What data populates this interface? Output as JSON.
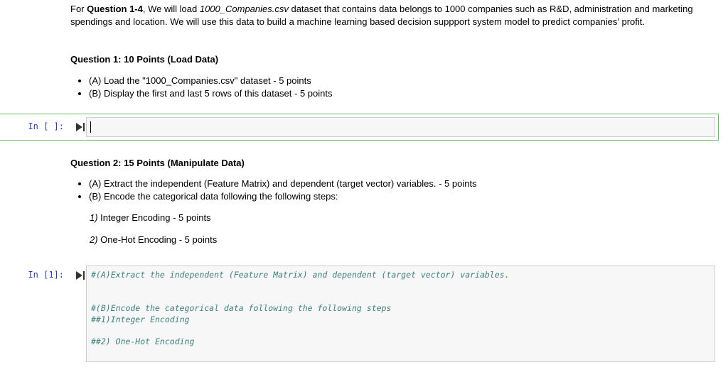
{
  "intro": {
    "p1": "For ",
    "bold": "Question 1-4",
    "p2": ", We will load ",
    "filename": "1000_Companies.csv",
    "p3": " dataset that contains data belongs to 1000 companies such as R&D, administration and marketing",
    "line2": "spendings and location. We will use this data to build a machine learning based decision suppport system model to predict companies' profit."
  },
  "question1": {
    "heading": "Question 1: 10 Points (Load Data)",
    "items": [
      "(A) Load the \"1000_Companies.csv\" dataset - 5 points",
      "(B) Display the first and last 5 rows of this dataset - 5 points"
    ]
  },
  "cell1": {
    "prompt": "In [ ]:",
    "code": ""
  },
  "question2": {
    "heading": "Question 2: 15 Points (Manipulate Data)",
    "items": [
      "(A) Extract the independent (Feature Matrix) and dependent (target vector) variables. - 5 points",
      "(B) Encode the categorical data following the following steps:"
    ],
    "step1_num": "1)",
    "step1_text": " Integer Encoding - 5 points",
    "step2_num": "2)",
    "step2_text": " One-Hot Encoding - 5 points"
  },
  "cell2": {
    "prompt": "In [1]:",
    "lines": [
      "#(A)Extract the independent (Feature Matrix) and dependent (target vector) variables.",
      "#(B)Encode the categorical data following the following steps",
      "##1)Integer Encoding",
      "##2) One-Hot Encoding"
    ]
  },
  "icons": {
    "run": "run-cell-icon"
  },
  "colors": {
    "prompt": "#303f9f",
    "comment": "#408080",
    "active_border": "#66bb6a"
  }
}
